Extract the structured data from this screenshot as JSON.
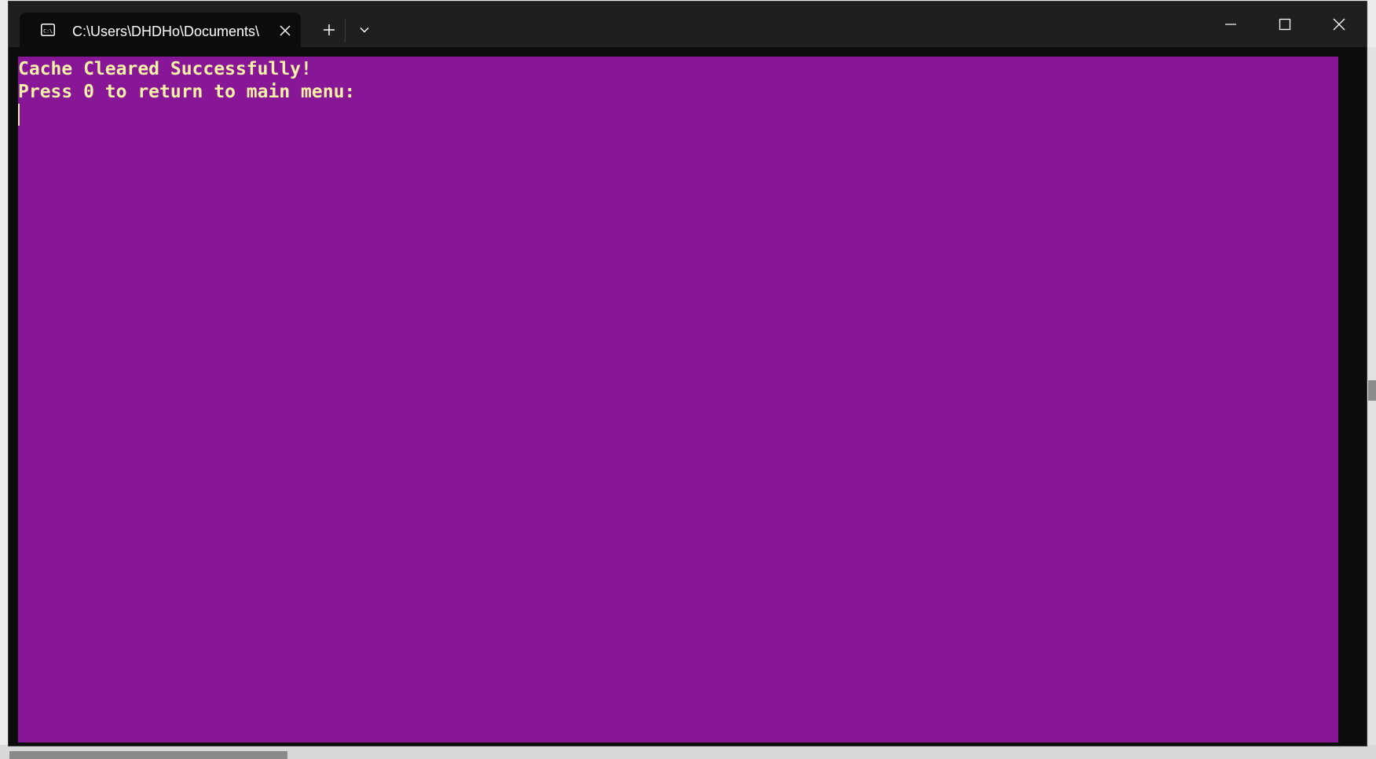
{
  "window": {
    "tab_title": "C:\\Users\\DHDHo\\Documents\\",
    "tab_icon": "cmd-icon",
    "new_tab_icon": "plus-icon",
    "dropdown_icon": "chevron-down-icon",
    "controls": {
      "minimize_icon": "minimize-icon",
      "maximize_icon": "maximize-icon",
      "close_icon": "close-icon"
    }
  },
  "terminal": {
    "lines": [
      "Cache Cleared Successfully!",
      "Press 0 to return to main menu:"
    ],
    "background_color": "#881798",
    "text_color": "#F9F1A5"
  }
}
